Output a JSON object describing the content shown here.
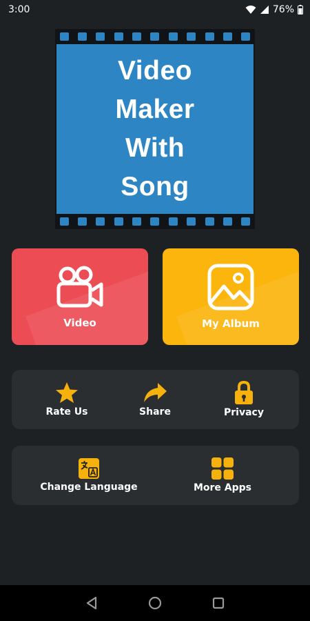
{
  "status": {
    "time": "3:00",
    "battery": "76%"
  },
  "banner": {
    "lines": [
      "Video",
      "Maker",
      "With",
      "Song"
    ]
  },
  "buttons": {
    "video": "Video",
    "album": "My Album"
  },
  "options": {
    "rate": "Rate Us",
    "share": "Share",
    "privacy": "Privacy"
  },
  "options2": {
    "language": "Change Language",
    "more": "More Apps"
  },
  "icons": {
    "status": [
      "wifi-icon",
      "signal-icon",
      "battery-icon"
    ],
    "video": "video-camera-icon",
    "album": "image-gallery-icon",
    "rate": "star-icon",
    "share": "share-arrow-icon",
    "privacy": "lock-icon",
    "language": "translate-icon",
    "more": "apps-grid-icon",
    "nav": [
      "back-icon",
      "home-icon",
      "recents-icon"
    ]
  },
  "colors": {
    "background": "#1d2124",
    "panel": "#2a2e31",
    "video_button": "#ec4c54",
    "album_button": "#fbb50d",
    "banner_blue": "#2e85c3",
    "accent_icon": "#f6b10d"
  }
}
